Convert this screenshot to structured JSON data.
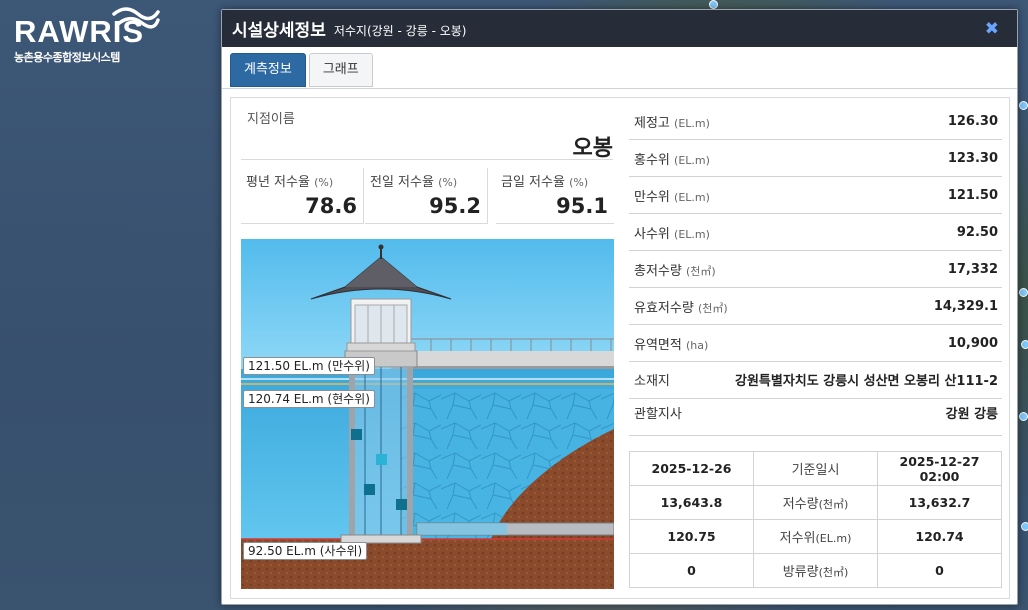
{
  "logo": {
    "title": "RAWRIS",
    "subtitle": "농촌용수종합정보시스템"
  },
  "modal": {
    "title": "시설상세정보",
    "subtitle": "저수지(강원 - 강릉 - 오봉)",
    "close_icon": "times-icon"
  },
  "tabs": [
    {
      "label": "계측정보",
      "active": true
    },
    {
      "label": "그래프",
      "active": false
    }
  ],
  "station": {
    "label": "지점이름",
    "name": "오봉"
  },
  "rates": [
    {
      "label": "평년 저수율",
      "unit": "(%)",
      "value": "78.6"
    },
    {
      "label": "전일 저수율",
      "unit": "(%)",
      "value": "95.2"
    },
    {
      "label": "금일 저수율",
      "unit": "(%)",
      "value": "95.1"
    }
  ],
  "diagram": {
    "full_level": "121.50 EL.m (만수위)",
    "current_level": "120.74 EL.m (현수위)",
    "dead_level": "92.50 EL.m (사수위)",
    "colors": {
      "sky": "#5ec3ee",
      "water": "#3fb1e2",
      "soil": "#8a4a2c",
      "tower_roof": "#55545a"
    }
  },
  "specs": [
    {
      "label": "제정고",
      "unit": "(EL.m)",
      "value": "126.30"
    },
    {
      "label": "홍수위",
      "unit": "(EL.m)",
      "value": "123.30"
    },
    {
      "label": "만수위",
      "unit": "(EL.m)",
      "value": "121.50"
    },
    {
      "label": "사수위",
      "unit": "(EL.m)",
      "value": "92.50"
    },
    {
      "label": "총저수량",
      "unit": "(천㎥)",
      "value": "17,332"
    },
    {
      "label": "유효저수량",
      "unit": "(천㎥)",
      "value": "14,329.1"
    },
    {
      "label": "유역면적",
      "unit": "(ha)",
      "value": "10,900"
    },
    {
      "label": "소재지",
      "unit": "",
      "value": "강원특별자치도 강릉시 성산면 오봉리 산111-2"
    },
    {
      "label": "관할지사",
      "unit": "",
      "value": "강원 강릉"
    }
  ],
  "comparison": {
    "header": {
      "prev_date": "2025-12-26",
      "label": "기준일시",
      "curr_date": "2025-12-27 02:00"
    },
    "rows": [
      {
        "prev": "13,643.8",
        "label": "저수량",
        "unit": "(천㎥)",
        "curr": "13,632.7"
      },
      {
        "prev": "120.75",
        "label": "저수위",
        "unit": "(EL.m)",
        "curr": "120.74"
      },
      {
        "prev": "0",
        "label": "방류량",
        "unit": "(천㎥)",
        "curr": "0"
      }
    ]
  }
}
